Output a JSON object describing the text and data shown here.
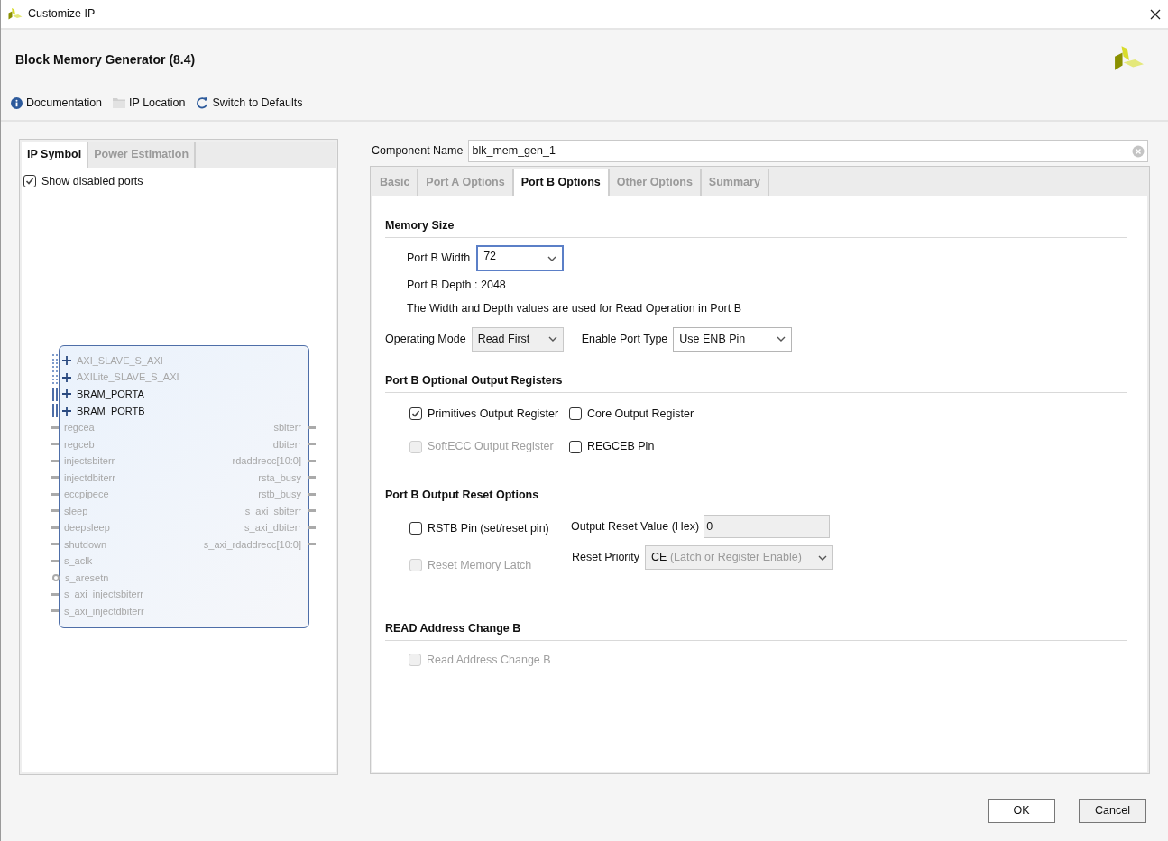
{
  "window": {
    "title": "Customize IP"
  },
  "header": {
    "title": "Block Memory Generator (8.4)",
    "toolbar": [
      {
        "kind": "info",
        "label": "Documentation"
      },
      {
        "kind": "folder",
        "label": "IP Location"
      },
      {
        "kind": "refresh",
        "label": "Switch to Defaults"
      }
    ]
  },
  "left_panel": {
    "tabs": [
      {
        "label": "IP Symbol",
        "selected": true
      },
      {
        "label": "Power Estimation",
        "selected": false
      }
    ],
    "show_disabled_ports": {
      "label": "Show disabled ports",
      "checked": true
    },
    "symbol": {
      "bus_ports": [
        {
          "name": "AXI_SLAVE_S_AXI",
          "disabled": true
        },
        {
          "name": "AXILite_SLAVE_S_AXI",
          "disabled": true
        },
        {
          "name": "BRAM_PORTA",
          "disabled": false
        },
        {
          "name": "BRAM_PORTB",
          "disabled": false
        }
      ],
      "left_ports": [
        {
          "name": "regcea",
          "kind": "pin"
        },
        {
          "name": "regceb",
          "kind": "pin"
        },
        {
          "name": "injectsbiterr",
          "kind": "pin"
        },
        {
          "name": "injectdbiterr",
          "kind": "pin"
        },
        {
          "name": "eccpipece",
          "kind": "pin"
        },
        {
          "name": "sleep",
          "kind": "pin"
        },
        {
          "name": "deepsleep",
          "kind": "pin"
        },
        {
          "name": "shutdown",
          "kind": "pin"
        },
        {
          "name": "s_aclk",
          "kind": "pin"
        },
        {
          "name": "s_aresetn",
          "kind": "inverted"
        },
        {
          "name": "s_axi_injectsbiterr",
          "kind": "pin"
        },
        {
          "name": "s_axi_injectdbiterr",
          "kind": "pin"
        }
      ],
      "right_ports": [
        "sbiterr",
        "dbiterr",
        "rdaddrecc[10:0]",
        "rsta_busy",
        "rstb_busy",
        "s_axi_sbiterr",
        "s_axi_dbiterr",
        "s_axi_rdaddrecc[10:0]"
      ]
    }
  },
  "component_name": {
    "label": "Component Name",
    "value": "blk_mem_gen_1"
  },
  "tabs": [
    {
      "label": "Basic",
      "selected": false
    },
    {
      "label": "Port A Options",
      "selected": false
    },
    {
      "label": "Port B Options",
      "selected": true
    },
    {
      "label": "Other Options",
      "selected": false
    },
    {
      "label": "Summary",
      "selected": false
    }
  ],
  "memory_size": {
    "title": "Memory Size",
    "port_b_width": {
      "label": "Port B Width",
      "value": "72"
    },
    "depth": "Port B Depth : 2048",
    "note": "The Width and Depth values are used for Read Operation in Port B",
    "operating_mode": {
      "label": "Operating Mode",
      "value": "Read First",
      "disabled": true
    },
    "enable_port_type": {
      "label": "Enable Port Type",
      "value": "Use ENB Pin",
      "disabled": false
    }
  },
  "output_registers": {
    "title": "Port B Optional Output Registers",
    "checkboxes": [
      {
        "label": "Primitives Output Register",
        "checked": true,
        "disabled": false
      },
      {
        "label": "Core Output Register",
        "checked": false,
        "disabled": false
      },
      {
        "label": "SoftECC Output Register",
        "checked": false,
        "disabled": true
      },
      {
        "label": "REGCEB Pin",
        "checked": false,
        "disabled": false
      }
    ]
  },
  "reset_options": {
    "title": "Port B Output Reset Options",
    "rstb_pin": {
      "label": "RSTB Pin (set/reset pin)",
      "checked": false,
      "disabled": false
    },
    "reset_memory_latch": {
      "label": "Reset Memory Latch",
      "checked": false,
      "disabled": true
    },
    "output_reset_value": {
      "label": "Output Reset Value (Hex)",
      "value": "0",
      "disabled": true
    },
    "reset_priority": {
      "label": "Reset Priority",
      "value": "CE",
      "value_detail": "(Latch or Register Enable)",
      "disabled": true
    }
  },
  "read_address_change": {
    "title": "READ Address Change B",
    "checkbox": {
      "label": "Read Address Change B",
      "checked": false,
      "disabled": true
    }
  },
  "buttons": [
    {
      "label": "OK"
    },
    {
      "label": "Cancel"
    }
  ]
}
